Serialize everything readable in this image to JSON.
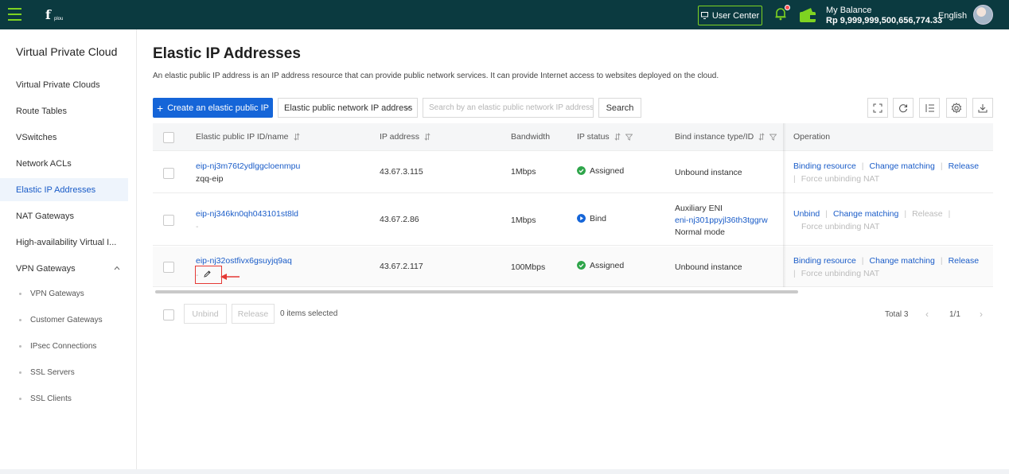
{
  "header": {
    "logo_text": "plou",
    "user_center_label": "User Center",
    "balance_label": "My Balance",
    "balance_value": "Rp 9,999,999,500,656,774.33",
    "language": "English",
    "accent_color": "#7ed321",
    "bar_color": "#0b3a40"
  },
  "sidebar": {
    "title": "Virtual Private Cloud",
    "items": [
      {
        "label": "Virtual Private Clouds"
      },
      {
        "label": "Route Tables"
      },
      {
        "label": "VSwitches"
      },
      {
        "label": "Network ACLs"
      },
      {
        "label": "Elastic IP Addresses",
        "active": true
      },
      {
        "label": "NAT Gateways"
      },
      {
        "label": "High-availability Virtual I..."
      },
      {
        "label": "VPN Gateways",
        "expanded": true
      }
    ],
    "sub_items": [
      {
        "label": "VPN Gateways"
      },
      {
        "label": "Customer Gateways"
      },
      {
        "label": "IPsec Connections"
      },
      {
        "label": "SSL Servers"
      },
      {
        "label": "SSL Clients"
      }
    ]
  },
  "main": {
    "title": "Elastic IP Addresses",
    "description": "An elastic public IP address is an IP address resource that can provide public network services. It can provide Internet access to websites deployed on the cloud.",
    "create_button": "Create an elastic public IP",
    "filter_select": "Elastic public network IP address",
    "search_placeholder": "Search by an elastic public network IP address",
    "search_button": "Search"
  },
  "table": {
    "columns": {
      "id_name": "Elastic public IP ID/name",
      "ip": "IP address",
      "bandwidth": "Bandwidth",
      "status": "IP status",
      "bind": "Bind instance type/ID",
      "operation": "Operation"
    },
    "rows": [
      {
        "id": "eip-nj3m76t2ydlggcloenmpu",
        "name": "zqq-eip",
        "ip": "43.67.3.115",
        "bandwidth": "1Mbps",
        "status": "Assigned",
        "bind_line1": "Unbound instance",
        "ops": {
          "a": "Binding resource",
          "b": "Change matching",
          "c": "Release",
          "d": "Force unbinding NAT"
        }
      },
      {
        "id": "eip-nj346kn0qh043101st8ld",
        "name": "-",
        "ip": "43.67.2.86",
        "bandwidth": "1Mbps",
        "status": "Bind",
        "bind_line1": "Auxiliary ENI",
        "bind_line2": "eni-nj301ppyjl36th3tggrw",
        "bind_line3": "Normal mode",
        "ops": {
          "a": "Unbind",
          "b": "Change matching",
          "c": "Release",
          "d": "Force unbinding NAT"
        }
      },
      {
        "id": "eip-nj32ostfivx6gsuyjq9aq",
        "name": "-",
        "ip": "43.67.2.117",
        "bandwidth": "100Mbps",
        "status": "Assigned",
        "bind_line1": "Unbound instance",
        "ops": {
          "a": "Binding resource",
          "b": "Change matching",
          "c": "Release",
          "d": "Force unbinding NAT"
        }
      }
    ]
  },
  "footer": {
    "unbind": "Unbind",
    "release": "Release",
    "selected": "0 items selected",
    "total": "Total 3",
    "page": "1/1"
  },
  "colors": {
    "primary": "#1565d8",
    "link": "#1a5cc8",
    "assigned": "#2ea54a",
    "bind": "#1565d8",
    "highlight": "#e53935"
  }
}
